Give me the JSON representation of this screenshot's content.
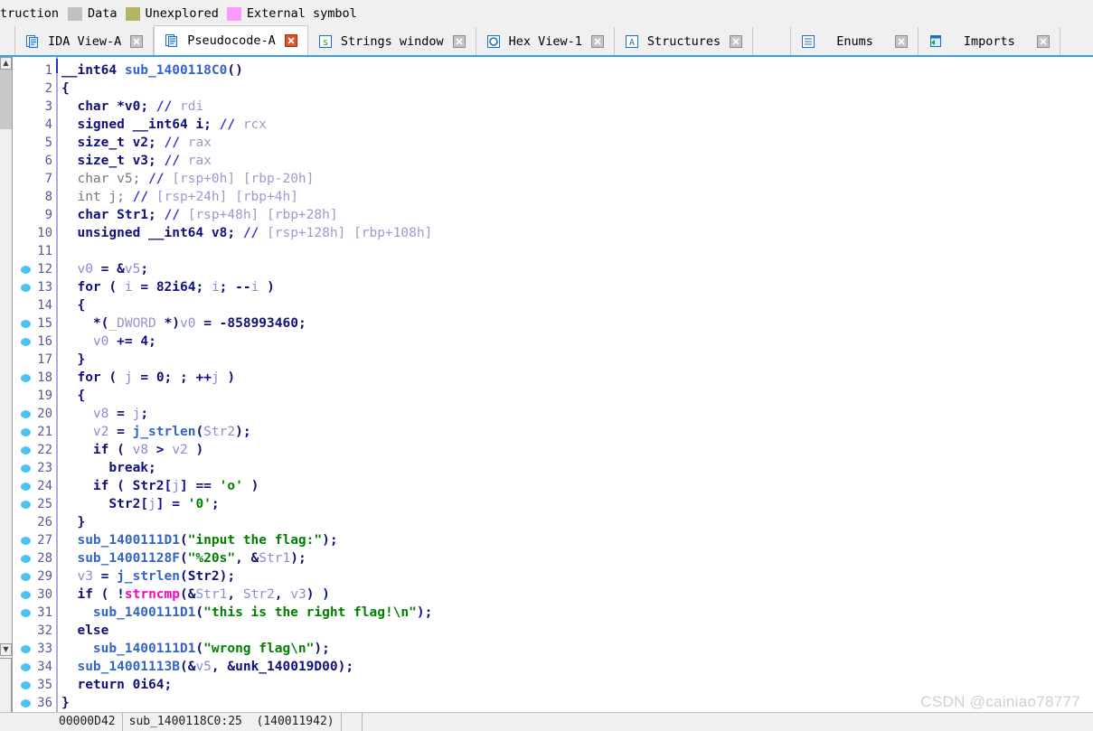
{
  "legend": {
    "items": [
      {
        "label": "truction",
        "color": "",
        "swatch": false
      },
      {
        "label": "Data",
        "color": "#c0c0c0",
        "swatch": true
      },
      {
        "label": "Unexplored",
        "color": "#b5b561",
        "swatch": true
      },
      {
        "label": "External symbol",
        "color": "#ff99ff",
        "swatch": true
      }
    ]
  },
  "tabs": [
    {
      "label": "IDA View-A",
      "icon": "ida-view-icon",
      "active": false,
      "close_color": "#a8a8a8"
    },
    {
      "label": "Pseudocode-A",
      "icon": "pseudocode-icon",
      "active": true,
      "close_color": "#e05030"
    },
    {
      "label": "Strings window",
      "icon": "strings-icon",
      "active": false,
      "close_color": "#a8a8a8"
    },
    {
      "label": "Hex View-1",
      "icon": "hex-view-icon",
      "active": false,
      "close_color": "#a8a8a8"
    },
    {
      "label": "Structures",
      "icon": "structures-icon",
      "active": false,
      "close_color": "#a8a8a8"
    },
    {
      "label": "",
      "icon": "blank-icon",
      "active": false,
      "close_color": ""
    },
    {
      "label": "Enums",
      "icon": "enums-icon",
      "active": false,
      "close_color": "#a8a8a8"
    },
    {
      "label": "Imports",
      "icon": "imports-icon",
      "active": false,
      "close_color": "#a8a8a8"
    }
  ],
  "code": {
    "function_name": "sub_1400118C0",
    "lines": [
      {
        "n": 1,
        "bp": false,
        "html": "<span class=\"typ\">__int64</span> <span class=\"fn\">sub_1400118C0</span><span class=\"pnc\">()</span>"
      },
      {
        "n": 2,
        "bp": false,
        "html": "<span class=\"pnc\">{</span>"
      },
      {
        "n": 3,
        "bp": false,
        "html": "  <span class=\"kw\">char</span> <span class=\"kw\">*</span><span class=\"kw\">v0</span><span class=\"pnc\">;</span> <span class=\"cmt\">//</span> <span class=\"cmt2\">rdi</span>"
      },
      {
        "n": 4,
        "bp": false,
        "html": "  <span class=\"kw\">signed __int64 i</span><span class=\"pnc\">;</span> <span class=\"cmt\">//</span> <span class=\"cmt2\">rcx</span>"
      },
      {
        "n": 5,
        "bp": false,
        "html": "  <span class=\"kw\">size_t v2</span><span class=\"pnc\">;</span> <span class=\"cmt\">//</span> <span class=\"cmt2\">rax</span>"
      },
      {
        "n": 6,
        "bp": false,
        "html": "  <span class=\"kw\">size_t v3</span><span class=\"pnc\">;</span> <span class=\"cmt\">//</span> <span class=\"cmt2\">rax</span>"
      },
      {
        "n": 7,
        "bp": false,
        "html": "  <span class=\"gry\">char v5;</span> <span class=\"cmt\">//</span> <span class=\"cmt2\">[rsp+0h] [rbp-20h]</span>"
      },
      {
        "n": 8,
        "bp": false,
        "html": "  <span class=\"gry\">int j;</span> <span class=\"cmt\">//</span> <span class=\"cmt2\">[rsp+24h] [rbp+4h]</span>"
      },
      {
        "n": 9,
        "bp": false,
        "html": "  <span class=\"kw\">char Str1</span><span class=\"pnc\">;</span> <span class=\"cmt\">//</span> <span class=\"cmt2\">[rsp+48h] [rbp+28h]</span>"
      },
      {
        "n": 10,
        "bp": false,
        "html": "  <span class=\"kw\">unsigned __int64 v8</span><span class=\"pnc\">;</span> <span class=\"cmt\">//</span> <span class=\"cmt2\">[rsp+128h] [rbp+108h]</span>"
      },
      {
        "n": 11,
        "bp": false,
        "html": ""
      },
      {
        "n": 12,
        "bp": true,
        "html": "  <span class=\"var\">v0</span> <span class=\"pnc\">= &amp;</span><span class=\"var\">v5</span><span class=\"pnc\">;</span>"
      },
      {
        "n": 13,
        "bp": true,
        "html": "  <span class=\"kw\">for</span> <span class=\"pnc\">(</span> <span class=\"var\">i</span> <span class=\"pnc\">=</span> <span class=\"num\">82i64</span><span class=\"pnc\">;</span> <span class=\"var\">i</span><span class=\"pnc\">;</span> <span class=\"pnc\">--</span><span class=\"var\">i</span> <span class=\"pnc\">)</span>"
      },
      {
        "n": 14,
        "bp": false,
        "html": "  <span class=\"pnc\">{</span>"
      },
      {
        "n": 15,
        "bp": true,
        "html": "    <span class=\"pnc\">*(</span><span class=\"dim\">_DWORD</span> <span class=\"pnc\">*)</span><span class=\"var\">v0</span> <span class=\"pnc\">=</span> <span class=\"num\">-858993460</span><span class=\"pnc\">;</span>"
      },
      {
        "n": 16,
        "bp": true,
        "html": "    <span class=\"var\">v0</span> <span class=\"pnc\">+=</span> <span class=\"num\">4</span><span class=\"pnc\">;</span>"
      },
      {
        "n": 17,
        "bp": false,
        "html": "  <span class=\"pnc\">}</span>"
      },
      {
        "n": 18,
        "bp": true,
        "html": "  <span class=\"kw\">for</span> <span class=\"pnc\">(</span> <span class=\"var\">j</span> <span class=\"pnc\">=</span> <span class=\"num\">0</span><span class=\"pnc\">;</span> <span class=\"pnc\">;</span> <span class=\"pnc\">++</span><span class=\"var\">j</span> <span class=\"pnc\">)</span>"
      },
      {
        "n": 19,
        "bp": false,
        "html": "  <span class=\"pnc\">{</span>"
      },
      {
        "n": 20,
        "bp": true,
        "html": "    <span class=\"var\">v8</span> <span class=\"pnc\">=</span> <span class=\"var\">j</span><span class=\"pnc\">;</span>"
      },
      {
        "n": 21,
        "bp": true,
        "html": "    <span class=\"var\">v2</span> <span class=\"pnc\">=</span> <span class=\"fn\">j_strlen</span><span class=\"pnc\">(</span><span class=\"var\">Str2</span><span class=\"pnc\">);</span>"
      },
      {
        "n": 22,
        "bp": true,
        "html": "    <span class=\"kw\">if</span> <span class=\"pnc\">(</span> <span class=\"var\">v8</span> <span class=\"pnc\">&gt;</span> <span class=\"var\">v2</span> <span class=\"pnc\">)</span>"
      },
      {
        "n": 23,
        "bp": true,
        "html": "      <span class=\"kw\">break</span><span class=\"pnc\">;</span>"
      },
      {
        "n": 24,
        "bp": true,
        "html": "    <span class=\"kw\">if</span> <span class=\"pnc\">(</span> <span class=\"kw\">Str2</span><span class=\"pnc\">[</span><span class=\"var\">j</span><span class=\"pnc\">] ==</span> <span class=\"str\">'o'</span> <span class=\"pnc\">)</span>"
      },
      {
        "n": 25,
        "bp": true,
        "html": "      <span class=\"kw\">Str2</span><span class=\"pnc\">[</span><span class=\"var\">j</span><span class=\"pnc\">] =</span> <span class=\"str\">'0'</span><span class=\"pnc\">;</span>"
      },
      {
        "n": 26,
        "bp": false,
        "html": "  <span class=\"pnc\">}</span>"
      },
      {
        "n": 27,
        "bp": true,
        "html": "  <span class=\"fn\">sub_1400111D1</span><span class=\"pnc\">(</span><span class=\"str\">\"input the flag:\"</span><span class=\"pnc\">);</span>"
      },
      {
        "n": 28,
        "bp": true,
        "html": "  <span class=\"fn\">sub_14001128F</span><span class=\"pnc\">(</span><span class=\"str\">\"%20s\"</span><span class=\"pnc\">, &amp;</span><span class=\"var\">Str1</span><span class=\"pnc\">);</span>"
      },
      {
        "n": 29,
        "bp": true,
        "html": "  <span class=\"var\">v3</span> <span class=\"pnc\">=</span> <span class=\"fn\">j_strlen</span><span class=\"pnc\">(</span><span class=\"kw\">Str2</span><span class=\"pnc\">);</span>"
      },
      {
        "n": 30,
        "bp": true,
        "html": "  <span class=\"kw\">if</span> <span class=\"pnc\">(</span> <span class=\"pnc\">!</span><span class=\"mag\">strncmp</span><span class=\"pnc\">(&amp;</span><span class=\"var\">Str1</span><span class=\"pnc\">,</span> <span class=\"var\">Str2</span><span class=\"pnc\">,</span> <span class=\"var\">v3</span><span class=\"pnc\">) )</span>"
      },
      {
        "n": 31,
        "bp": true,
        "html": "    <span class=\"fn\">sub_1400111D1</span><span class=\"pnc\">(</span><span class=\"str\">\"this is the right flag!\\n\"</span><span class=\"pnc\">);</span>"
      },
      {
        "n": 32,
        "bp": false,
        "html": "  <span class=\"kw\">else</span>"
      },
      {
        "n": 33,
        "bp": true,
        "html": "    <span class=\"fn\">sub_1400111D1</span><span class=\"pnc\">(</span><span class=\"str\">\"wrong flag\\n\"</span><span class=\"pnc\">);</span>"
      },
      {
        "n": 34,
        "bp": true,
        "html": "  <span class=\"fn\">sub_14001113B</span><span class=\"pnc\">(&amp;</span><span class=\"var\">v5</span><span class=\"pnc\">, &amp;</span><span class=\"kw\">unk_140019D00</span><span class=\"pnc\">);</span>"
      },
      {
        "n": 35,
        "bp": true,
        "html": "  <span class=\"kw\">return</span> <span class=\"num\">0i64</span><span class=\"pnc\">;</span>"
      },
      {
        "n": 36,
        "bp": true,
        "html": "<span class=\"pnc\">}</span>"
      }
    ]
  },
  "status_bar": {
    "offset": "00000D42",
    "location": "sub_1400118C0:25  (140011942)"
  },
  "watermark": "CSDN @cainiao78777",
  "colors": {
    "accent": "#3aa0e0",
    "breakpoint": "#4ec3f0",
    "string": "#008000",
    "function": "#3264c8",
    "keyword": "#10107a",
    "magenta": "#ff00c8"
  }
}
